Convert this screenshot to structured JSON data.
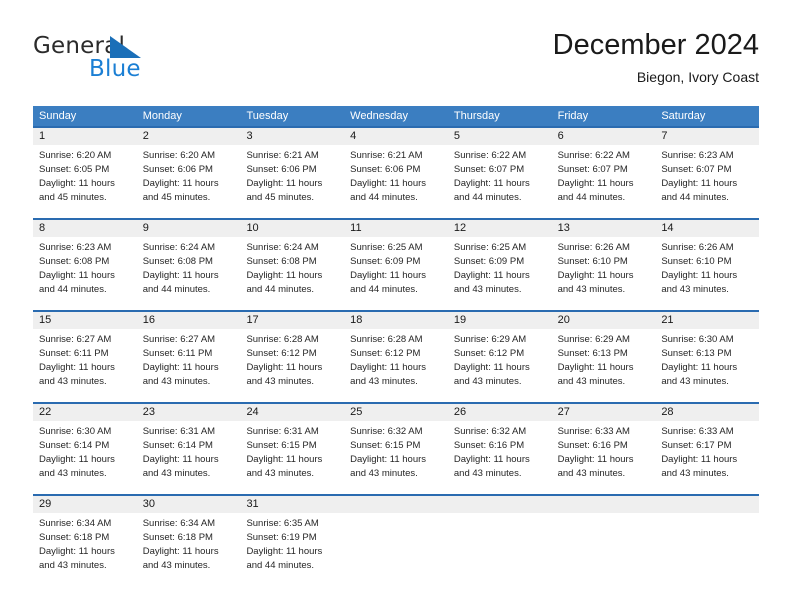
{
  "brand": {
    "name_part1": "General",
    "name_part2": "Blue",
    "logo_icon": "triangle-flag-icon"
  },
  "header": {
    "title": "December 2024",
    "location": "Biegon, Ivory Coast"
  },
  "weekdays": [
    "Sunday",
    "Monday",
    "Tuesday",
    "Wednesday",
    "Thursday",
    "Friday",
    "Saturday"
  ],
  "colors": {
    "header_band": "#3b7ec1",
    "week_top_border": "#2a6bb0",
    "day_number_band": "#efefef",
    "brand_blue": "#1b7fd4",
    "text": "#262626"
  },
  "weeks": [
    [
      {
        "day": "1",
        "sunrise": "Sunrise: 6:20 AM",
        "sunset": "Sunset: 6:05 PM",
        "daylight1": "Daylight: 11 hours",
        "daylight2": "and 45 minutes."
      },
      {
        "day": "2",
        "sunrise": "Sunrise: 6:20 AM",
        "sunset": "Sunset: 6:06 PM",
        "daylight1": "Daylight: 11 hours",
        "daylight2": "and 45 minutes."
      },
      {
        "day": "3",
        "sunrise": "Sunrise: 6:21 AM",
        "sunset": "Sunset: 6:06 PM",
        "daylight1": "Daylight: 11 hours",
        "daylight2": "and 45 minutes."
      },
      {
        "day": "4",
        "sunrise": "Sunrise: 6:21 AM",
        "sunset": "Sunset: 6:06 PM",
        "daylight1": "Daylight: 11 hours",
        "daylight2": "and 44 minutes."
      },
      {
        "day": "5",
        "sunrise": "Sunrise: 6:22 AM",
        "sunset": "Sunset: 6:07 PM",
        "daylight1": "Daylight: 11 hours",
        "daylight2": "and 44 minutes."
      },
      {
        "day": "6",
        "sunrise": "Sunrise: 6:22 AM",
        "sunset": "Sunset: 6:07 PM",
        "daylight1": "Daylight: 11 hours",
        "daylight2": "and 44 minutes."
      },
      {
        "day": "7",
        "sunrise": "Sunrise: 6:23 AM",
        "sunset": "Sunset: 6:07 PM",
        "daylight1": "Daylight: 11 hours",
        "daylight2": "and 44 minutes."
      }
    ],
    [
      {
        "day": "8",
        "sunrise": "Sunrise: 6:23 AM",
        "sunset": "Sunset: 6:08 PM",
        "daylight1": "Daylight: 11 hours",
        "daylight2": "and 44 minutes."
      },
      {
        "day": "9",
        "sunrise": "Sunrise: 6:24 AM",
        "sunset": "Sunset: 6:08 PM",
        "daylight1": "Daylight: 11 hours",
        "daylight2": "and 44 minutes."
      },
      {
        "day": "10",
        "sunrise": "Sunrise: 6:24 AM",
        "sunset": "Sunset: 6:08 PM",
        "daylight1": "Daylight: 11 hours",
        "daylight2": "and 44 minutes."
      },
      {
        "day": "11",
        "sunrise": "Sunrise: 6:25 AM",
        "sunset": "Sunset: 6:09 PM",
        "daylight1": "Daylight: 11 hours",
        "daylight2": "and 44 minutes."
      },
      {
        "day": "12",
        "sunrise": "Sunrise: 6:25 AM",
        "sunset": "Sunset: 6:09 PM",
        "daylight1": "Daylight: 11 hours",
        "daylight2": "and 43 minutes."
      },
      {
        "day": "13",
        "sunrise": "Sunrise: 6:26 AM",
        "sunset": "Sunset: 6:10 PM",
        "daylight1": "Daylight: 11 hours",
        "daylight2": "and 43 minutes."
      },
      {
        "day": "14",
        "sunrise": "Sunrise: 6:26 AM",
        "sunset": "Sunset: 6:10 PM",
        "daylight1": "Daylight: 11 hours",
        "daylight2": "and 43 minutes."
      }
    ],
    [
      {
        "day": "15",
        "sunrise": "Sunrise: 6:27 AM",
        "sunset": "Sunset: 6:11 PM",
        "daylight1": "Daylight: 11 hours",
        "daylight2": "and 43 minutes."
      },
      {
        "day": "16",
        "sunrise": "Sunrise: 6:27 AM",
        "sunset": "Sunset: 6:11 PM",
        "daylight1": "Daylight: 11 hours",
        "daylight2": "and 43 minutes."
      },
      {
        "day": "17",
        "sunrise": "Sunrise: 6:28 AM",
        "sunset": "Sunset: 6:12 PM",
        "daylight1": "Daylight: 11 hours",
        "daylight2": "and 43 minutes."
      },
      {
        "day": "18",
        "sunrise": "Sunrise: 6:28 AM",
        "sunset": "Sunset: 6:12 PM",
        "daylight1": "Daylight: 11 hours",
        "daylight2": "and 43 minutes."
      },
      {
        "day": "19",
        "sunrise": "Sunrise: 6:29 AM",
        "sunset": "Sunset: 6:12 PM",
        "daylight1": "Daylight: 11 hours",
        "daylight2": "and 43 minutes."
      },
      {
        "day": "20",
        "sunrise": "Sunrise: 6:29 AM",
        "sunset": "Sunset: 6:13 PM",
        "daylight1": "Daylight: 11 hours",
        "daylight2": "and 43 minutes."
      },
      {
        "day": "21",
        "sunrise": "Sunrise: 6:30 AM",
        "sunset": "Sunset: 6:13 PM",
        "daylight1": "Daylight: 11 hours",
        "daylight2": "and 43 minutes."
      }
    ],
    [
      {
        "day": "22",
        "sunrise": "Sunrise: 6:30 AM",
        "sunset": "Sunset: 6:14 PM",
        "daylight1": "Daylight: 11 hours",
        "daylight2": "and 43 minutes."
      },
      {
        "day": "23",
        "sunrise": "Sunrise: 6:31 AM",
        "sunset": "Sunset: 6:14 PM",
        "daylight1": "Daylight: 11 hours",
        "daylight2": "and 43 minutes."
      },
      {
        "day": "24",
        "sunrise": "Sunrise: 6:31 AM",
        "sunset": "Sunset: 6:15 PM",
        "daylight1": "Daylight: 11 hours",
        "daylight2": "and 43 minutes."
      },
      {
        "day": "25",
        "sunrise": "Sunrise: 6:32 AM",
        "sunset": "Sunset: 6:15 PM",
        "daylight1": "Daylight: 11 hours",
        "daylight2": "and 43 minutes."
      },
      {
        "day": "26",
        "sunrise": "Sunrise: 6:32 AM",
        "sunset": "Sunset: 6:16 PM",
        "daylight1": "Daylight: 11 hours",
        "daylight2": "and 43 minutes."
      },
      {
        "day": "27",
        "sunrise": "Sunrise: 6:33 AM",
        "sunset": "Sunset: 6:16 PM",
        "daylight1": "Daylight: 11 hours",
        "daylight2": "and 43 minutes."
      },
      {
        "day": "28",
        "sunrise": "Sunrise: 6:33 AM",
        "sunset": "Sunset: 6:17 PM",
        "daylight1": "Daylight: 11 hours",
        "daylight2": "and 43 minutes."
      }
    ],
    [
      {
        "day": "29",
        "sunrise": "Sunrise: 6:34 AM",
        "sunset": "Sunset: 6:18 PM",
        "daylight1": "Daylight: 11 hours",
        "daylight2": "and 43 minutes."
      },
      {
        "day": "30",
        "sunrise": "Sunrise: 6:34 AM",
        "sunset": "Sunset: 6:18 PM",
        "daylight1": "Daylight: 11 hours",
        "daylight2": "and 43 minutes."
      },
      {
        "day": "31",
        "sunrise": "Sunrise: 6:35 AM",
        "sunset": "Sunset: 6:19 PM",
        "daylight1": "Daylight: 11 hours",
        "daylight2": "and 44 minutes."
      },
      {
        "day": "",
        "sunrise": "",
        "sunset": "",
        "daylight1": "",
        "daylight2": ""
      },
      {
        "day": "",
        "sunrise": "",
        "sunset": "",
        "daylight1": "",
        "daylight2": ""
      },
      {
        "day": "",
        "sunrise": "",
        "sunset": "",
        "daylight1": "",
        "daylight2": ""
      },
      {
        "day": "",
        "sunrise": "",
        "sunset": "",
        "daylight1": "",
        "daylight2": ""
      }
    ]
  ]
}
